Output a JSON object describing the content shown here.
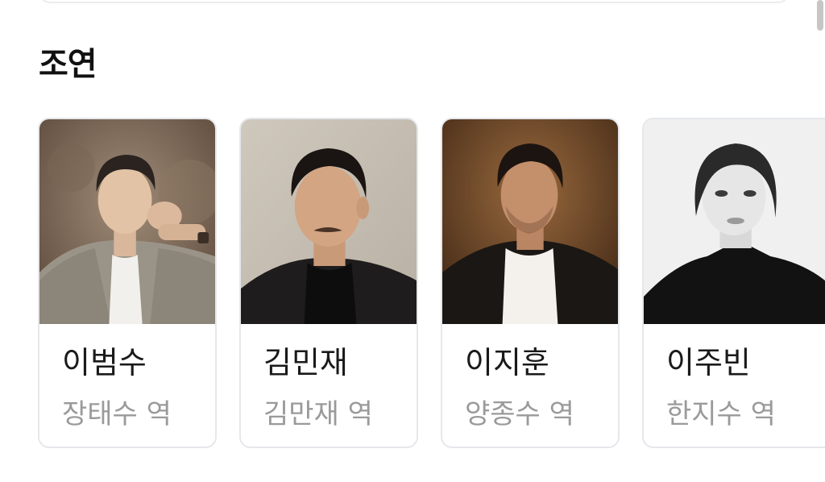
{
  "section": {
    "title": "조연"
  },
  "cast": [
    {
      "name": "이범수",
      "role": "장태수 역"
    },
    {
      "name": "김민재",
      "role": "김만재 역"
    },
    {
      "name": "이지훈",
      "role": "양종수 역"
    },
    {
      "name": "이주빈",
      "role": "한지수 역"
    }
  ]
}
